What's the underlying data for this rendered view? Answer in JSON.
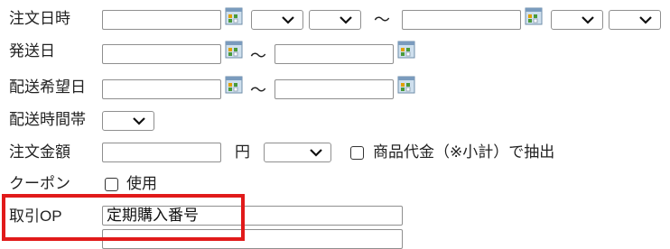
{
  "rows": {
    "order_datetime": {
      "label": "注文日時",
      "from_date": "",
      "to_date": "",
      "range_sep": "～"
    },
    "ship_date": {
      "label": "発送日",
      "from_date": "",
      "to_date": "",
      "range_sep": "～"
    },
    "desired_delivery_date": {
      "label": "配送希望日",
      "from_date": "",
      "to_date": "",
      "range_sep": "～"
    },
    "delivery_time_slot": {
      "label": "配送時間帯"
    },
    "order_amount": {
      "label": "注文金額",
      "value": "",
      "unit": "円",
      "checkbox_label": "商品代金（※小計）で抽出",
      "checked": false
    },
    "coupon": {
      "label": "クーポン",
      "checkbox_label": "使用",
      "checked": false
    },
    "transaction_op": {
      "label": "取引OP",
      "value": "定期購入番号"
    }
  },
  "icons": {
    "calendar": "calendar-icon",
    "dropdown": "chevron-down-icon"
  },
  "colors": {
    "highlight": "#e11a1a",
    "border": "#8f8f8f"
  }
}
